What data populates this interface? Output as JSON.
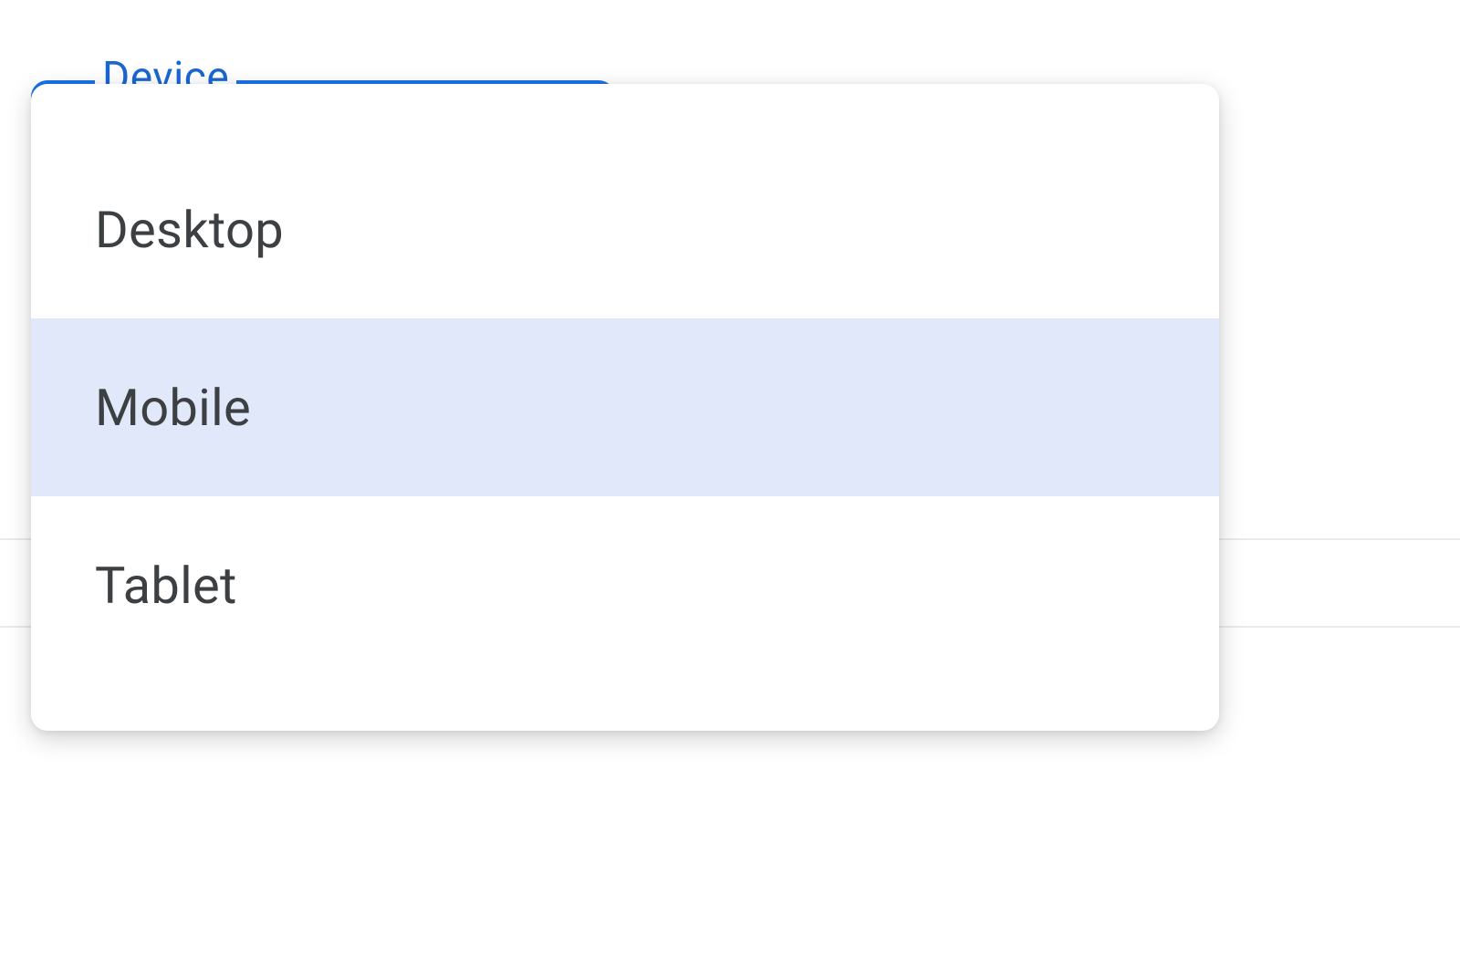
{
  "field": {
    "label": "Device"
  },
  "dropdown": {
    "options": [
      {
        "label": "Desktop",
        "selected": false
      },
      {
        "label": "Mobile",
        "selected": true
      },
      {
        "label": "Tablet",
        "selected": false
      }
    ]
  }
}
